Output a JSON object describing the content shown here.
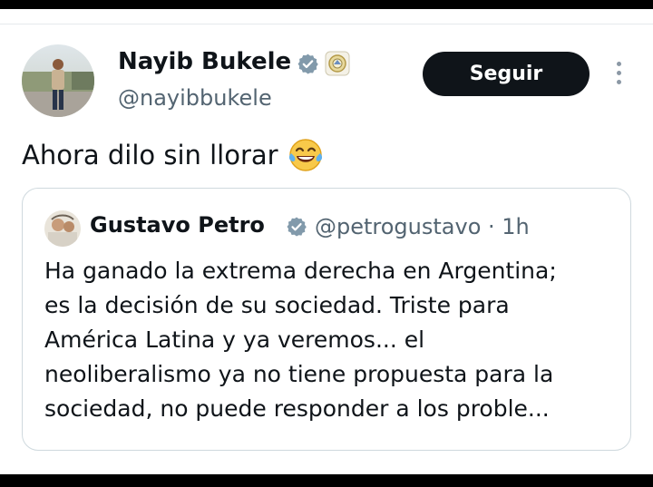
{
  "author": {
    "name": "Nayib Bukele",
    "handle": "@nayibbukele",
    "verified_icon": "verified-badge-icon",
    "affiliate_icon": "el-salvador-seal-icon"
  },
  "actions": {
    "follow_label": "Seguir",
    "more_icon": "more-vertical-icon"
  },
  "tweet": {
    "text": "Ahora dilo sin llorar",
    "emoji_icon": "tears-of-joy-emoji"
  },
  "quote": {
    "name": "Gustavo Petro",
    "handle_time": "@petrogustavo · 1h",
    "body": "Ha ganado la extrema derecha en Argentina;\nes la decisión de su sociedad. Triste para\nAmérica Latina y ya veremos... el\nneoliberalismo ya no tiene propuesta para la\nsociedad, no puede responder a los proble..."
  },
  "colors": {
    "text": "#0f1419",
    "secondary": "#536471",
    "verified": "#829aab",
    "button": "#0f1419"
  }
}
